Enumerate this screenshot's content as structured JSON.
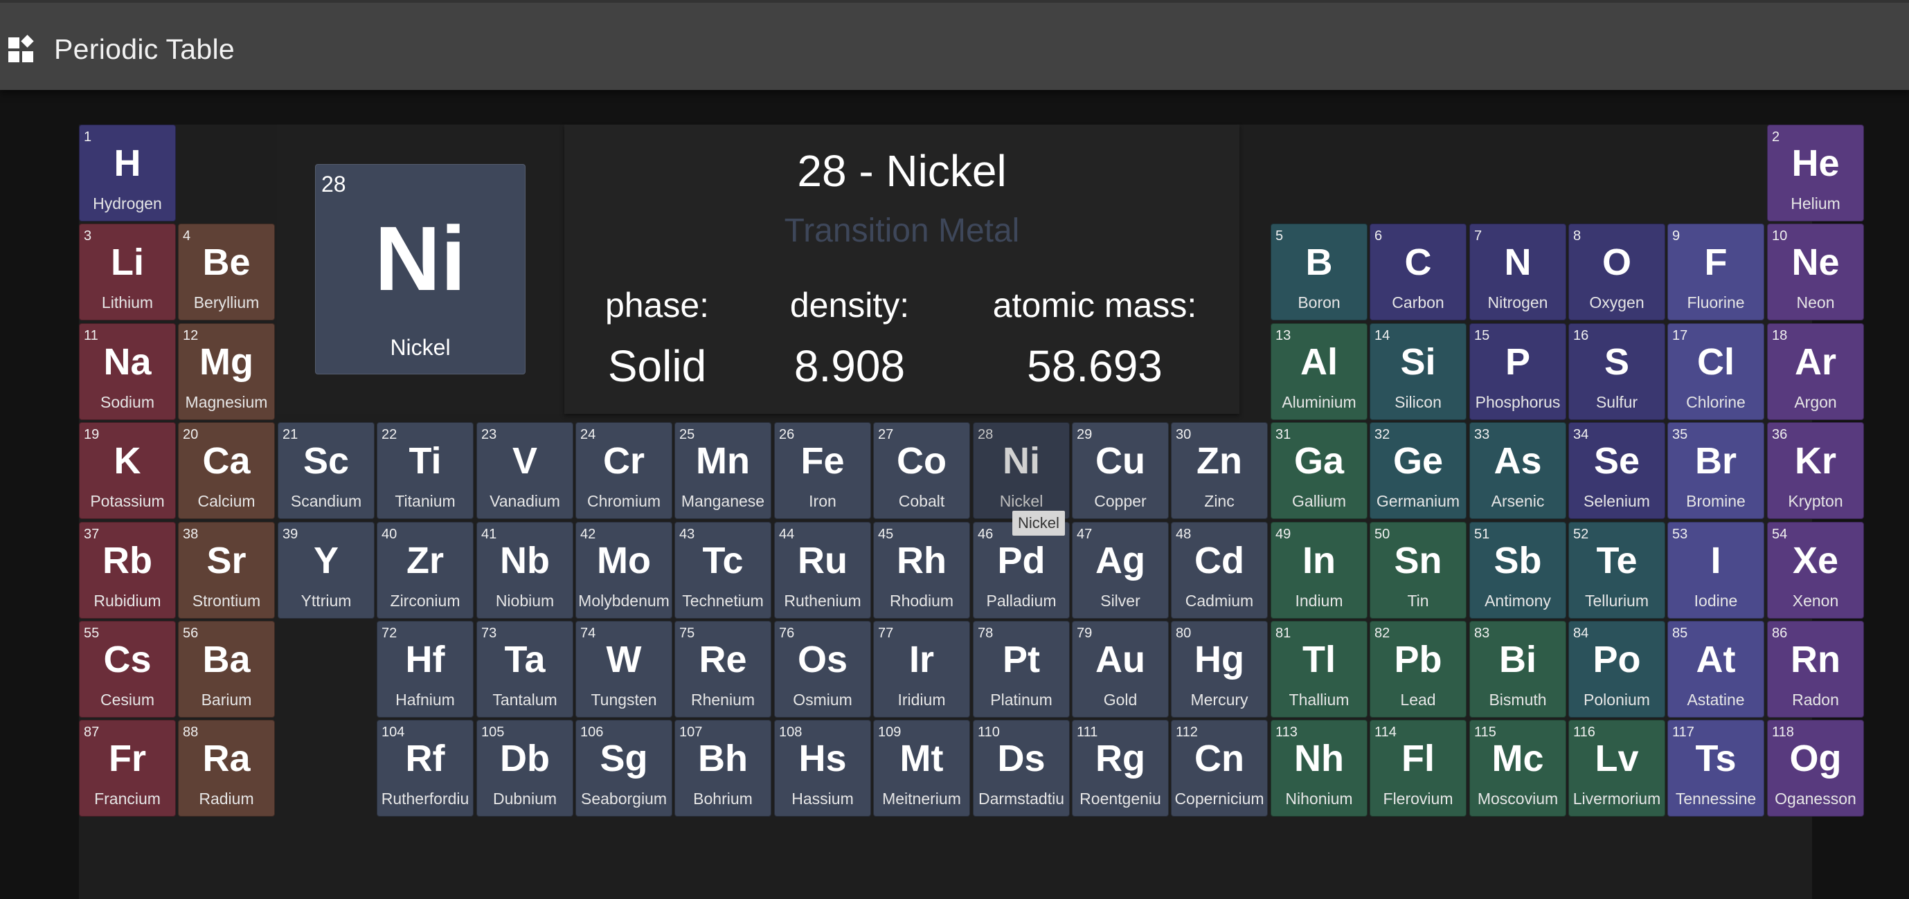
{
  "app": {
    "title": "Periodic Table",
    "icon": "widgets-icon"
  },
  "detail": {
    "number": "28",
    "symbol": "Ni",
    "name": "Nickel",
    "title": "28 - Nickel",
    "category": "Transition Metal",
    "phase_label": "phase:",
    "phase": "Solid",
    "density_label": "density:",
    "density": "8.908",
    "mass_label": "atomic mass:",
    "mass": "58.693"
  },
  "tooltip": "Nickel",
  "selected_number": "28",
  "colors": {
    "background": "#121212",
    "appbar": "#424242",
    "board": "#1e1e1e",
    "nonmetal": "#3a3770",
    "alkali": "#6b2e3a",
    "alkaline_earth": "#5f4136",
    "transition": "#3e475a",
    "post_transition": "#2f5c48",
    "metalloid": "#2b525b",
    "halogen": "#4b4a8c",
    "noble_gas": "#583a7e"
  },
  "elements": [
    {
      "n": "1",
      "s": "H",
      "name": "Hydrogen",
      "cat": "nonmetal"
    },
    {
      "n": "2",
      "s": "He",
      "name": "Helium",
      "cat": "noble_gas"
    },
    {
      "n": "3",
      "s": "Li",
      "name": "Lithium",
      "cat": "alkali"
    },
    {
      "n": "4",
      "s": "Be",
      "name": "Beryllium",
      "cat": "alkaline_earth"
    },
    {
      "n": "5",
      "s": "B",
      "name": "Boron",
      "cat": "metalloid"
    },
    {
      "n": "6",
      "s": "C",
      "name": "Carbon",
      "cat": "nonmetal"
    },
    {
      "n": "7",
      "s": "N",
      "name": "Nitrogen",
      "cat": "nonmetal"
    },
    {
      "n": "8",
      "s": "O",
      "name": "Oxygen",
      "cat": "nonmetal"
    },
    {
      "n": "9",
      "s": "F",
      "name": "Fluorine",
      "cat": "halogen"
    },
    {
      "n": "10",
      "s": "Ne",
      "name": "Neon",
      "cat": "noble_gas"
    },
    {
      "n": "11",
      "s": "Na",
      "name": "Sodium",
      "cat": "alkali"
    },
    {
      "n": "12",
      "s": "Mg",
      "name": "Magnesium",
      "cat": "alkaline_earth"
    },
    {
      "n": "13",
      "s": "Al",
      "name": "Aluminium",
      "cat": "post_transition"
    },
    {
      "n": "14",
      "s": "Si",
      "name": "Silicon",
      "cat": "metalloid"
    },
    {
      "n": "15",
      "s": "P",
      "name": "Phosphorus",
      "cat": "nonmetal"
    },
    {
      "n": "16",
      "s": "S",
      "name": "Sulfur",
      "cat": "nonmetal"
    },
    {
      "n": "17",
      "s": "Cl",
      "name": "Chlorine",
      "cat": "halogen"
    },
    {
      "n": "18",
      "s": "Ar",
      "name": "Argon",
      "cat": "noble_gas"
    },
    {
      "n": "19",
      "s": "K",
      "name": "Potassium",
      "cat": "alkali"
    },
    {
      "n": "20",
      "s": "Ca",
      "name": "Calcium",
      "cat": "alkaline_earth"
    },
    {
      "n": "21",
      "s": "Sc",
      "name": "Scandium",
      "cat": "transition"
    },
    {
      "n": "22",
      "s": "Ti",
      "name": "Titanium",
      "cat": "transition"
    },
    {
      "n": "23",
      "s": "V",
      "name": "Vanadium",
      "cat": "transition"
    },
    {
      "n": "24",
      "s": "Cr",
      "name": "Chromium",
      "cat": "transition"
    },
    {
      "n": "25",
      "s": "Mn",
      "name": "Manganese",
      "cat": "transition"
    },
    {
      "n": "26",
      "s": "Fe",
      "name": "Iron",
      "cat": "transition"
    },
    {
      "n": "27",
      "s": "Co",
      "name": "Cobalt",
      "cat": "transition"
    },
    {
      "n": "28",
      "s": "Ni",
      "name": "Nickel",
      "cat": "transition"
    },
    {
      "n": "29",
      "s": "Cu",
      "name": "Copper",
      "cat": "transition"
    },
    {
      "n": "30",
      "s": "Zn",
      "name": "Zinc",
      "cat": "transition"
    },
    {
      "n": "31",
      "s": "Ga",
      "name": "Gallium",
      "cat": "post_transition"
    },
    {
      "n": "32",
      "s": "Ge",
      "name": "Germanium",
      "cat": "metalloid"
    },
    {
      "n": "33",
      "s": "As",
      "name": "Arsenic",
      "cat": "metalloid"
    },
    {
      "n": "34",
      "s": "Se",
      "name": "Selenium",
      "cat": "nonmetal"
    },
    {
      "n": "35",
      "s": "Br",
      "name": "Bromine",
      "cat": "halogen"
    },
    {
      "n": "36",
      "s": "Kr",
      "name": "Krypton",
      "cat": "noble_gas"
    },
    {
      "n": "37",
      "s": "Rb",
      "name": "Rubidium",
      "cat": "alkali"
    },
    {
      "n": "38",
      "s": "Sr",
      "name": "Strontium",
      "cat": "alkaline_earth"
    },
    {
      "n": "39",
      "s": "Y",
      "name": "Yttrium",
      "cat": "transition"
    },
    {
      "n": "40",
      "s": "Zr",
      "name": "Zirconium",
      "cat": "transition"
    },
    {
      "n": "41",
      "s": "Nb",
      "name": "Niobium",
      "cat": "transition"
    },
    {
      "n": "42",
      "s": "Mo",
      "name": "Molybdenum",
      "cat": "transition"
    },
    {
      "n": "43",
      "s": "Tc",
      "name": "Technetium",
      "cat": "transition"
    },
    {
      "n": "44",
      "s": "Ru",
      "name": "Ruthenium",
      "cat": "transition"
    },
    {
      "n": "45",
      "s": "Rh",
      "name": "Rhodium",
      "cat": "transition"
    },
    {
      "n": "46",
      "s": "Pd",
      "name": "Palladium",
      "cat": "transition"
    },
    {
      "n": "47",
      "s": "Ag",
      "name": "Silver",
      "cat": "transition"
    },
    {
      "n": "48",
      "s": "Cd",
      "name": "Cadmium",
      "cat": "transition"
    },
    {
      "n": "49",
      "s": "In",
      "name": "Indium",
      "cat": "post_transition"
    },
    {
      "n": "50",
      "s": "Sn",
      "name": "Tin",
      "cat": "post_transition"
    },
    {
      "n": "51",
      "s": "Sb",
      "name": "Antimony",
      "cat": "metalloid"
    },
    {
      "n": "52",
      "s": "Te",
      "name": "Tellurium",
      "cat": "metalloid"
    },
    {
      "n": "53",
      "s": "I",
      "name": "Iodine",
      "cat": "halogen"
    },
    {
      "n": "54",
      "s": "Xe",
      "name": "Xenon",
      "cat": "noble_gas"
    },
    {
      "n": "55",
      "s": "Cs",
      "name": "Cesium",
      "cat": "alkali"
    },
    {
      "n": "56",
      "s": "Ba",
      "name": "Barium",
      "cat": "alkaline_earth"
    },
    {
      "n": "72",
      "s": "Hf",
      "name": "Hafnium",
      "cat": "transition"
    },
    {
      "n": "73",
      "s": "Ta",
      "name": "Tantalum",
      "cat": "transition"
    },
    {
      "n": "74",
      "s": "W",
      "name": "Tungsten",
      "cat": "transition"
    },
    {
      "n": "75",
      "s": "Re",
      "name": "Rhenium",
      "cat": "transition"
    },
    {
      "n": "76",
      "s": "Os",
      "name": "Osmium",
      "cat": "transition"
    },
    {
      "n": "77",
      "s": "Ir",
      "name": "Iridium",
      "cat": "transition"
    },
    {
      "n": "78",
      "s": "Pt",
      "name": "Platinum",
      "cat": "transition"
    },
    {
      "n": "79",
      "s": "Au",
      "name": "Gold",
      "cat": "transition"
    },
    {
      "n": "80",
      "s": "Hg",
      "name": "Mercury",
      "cat": "transition"
    },
    {
      "n": "81",
      "s": "Tl",
      "name": "Thallium",
      "cat": "post_transition"
    },
    {
      "n": "82",
      "s": "Pb",
      "name": "Lead",
      "cat": "post_transition"
    },
    {
      "n": "83",
      "s": "Bi",
      "name": "Bismuth",
      "cat": "post_transition"
    },
    {
      "n": "84",
      "s": "Po",
      "name": "Polonium",
      "cat": "metalloid"
    },
    {
      "n": "85",
      "s": "At",
      "name": "Astatine",
      "cat": "halogen"
    },
    {
      "n": "86",
      "s": "Rn",
      "name": "Radon",
      "cat": "noble_gas"
    },
    {
      "n": "87",
      "s": "Fr",
      "name": "Francium",
      "cat": "alkali"
    },
    {
      "n": "88",
      "s": "Ra",
      "name": "Radium",
      "cat": "alkaline_earth"
    },
    {
      "n": "104",
      "s": "Rf",
      "name": "Rutherfordiu",
      "cat": "transition"
    },
    {
      "n": "105",
      "s": "Db",
      "name": "Dubnium",
      "cat": "transition"
    },
    {
      "n": "106",
      "s": "Sg",
      "name": "Seaborgium",
      "cat": "transition"
    },
    {
      "n": "107",
      "s": "Bh",
      "name": "Bohrium",
      "cat": "transition"
    },
    {
      "n": "108",
      "s": "Hs",
      "name": "Hassium",
      "cat": "transition"
    },
    {
      "n": "109",
      "s": "Mt",
      "name": "Meitnerium",
      "cat": "transition"
    },
    {
      "n": "110",
      "s": "Ds",
      "name": "Darmstadtiu",
      "cat": "transition"
    },
    {
      "n": "111",
      "s": "Rg",
      "name": "Roentgeniu",
      "cat": "transition"
    },
    {
      "n": "112",
      "s": "Cn",
      "name": "Copernicium",
      "cat": "transition"
    },
    {
      "n": "113",
      "s": "Nh",
      "name": "Nihonium",
      "cat": "post_transition"
    },
    {
      "n": "114",
      "s": "Fl",
      "name": "Flerovium",
      "cat": "post_transition"
    },
    {
      "n": "115",
      "s": "Mc",
      "name": "Moscovium",
      "cat": "post_transition"
    },
    {
      "n": "116",
      "s": "Lv",
      "name": "Livermorium",
      "cat": "post_transition"
    },
    {
      "n": "117",
      "s": "Ts",
      "name": "Tennessine",
      "cat": "halogen"
    },
    {
      "n": "118",
      "s": "Og",
      "name": "Oganesson",
      "cat": "noble_gas"
    }
  ]
}
